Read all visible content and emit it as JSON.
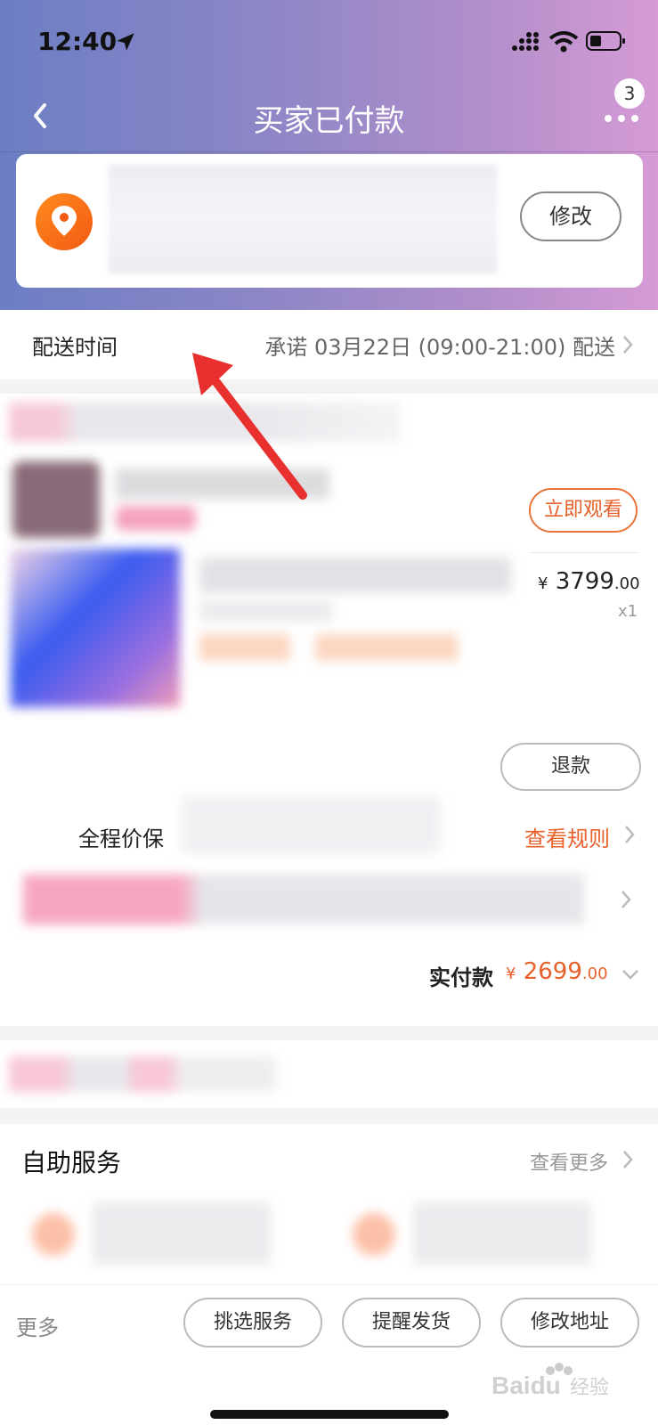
{
  "status_bar": {
    "time": "12:40"
  },
  "nav": {
    "title": "买家已付款",
    "more_badge": "3"
  },
  "address_card": {
    "modify_label": "修改"
  },
  "delivery": {
    "label": "配送时间",
    "value": "承诺 03月22日 (09:00-21:00) 配送"
  },
  "order": {
    "watch_label": "立即观看",
    "price_currency": "¥",
    "price_int": "3799",
    "price_dec": ".00",
    "quantity": "x1",
    "refund_label": "退款",
    "guarantee_label": "全程价保",
    "guarantee_link": "查看规则",
    "paid_label": "实付款",
    "paid_currency": "¥",
    "paid_int": "2699",
    "paid_dec": ".00"
  },
  "self_service": {
    "title": "自助服务",
    "more_label": "查看更多"
  },
  "bottom_bar": {
    "more_label": "更多",
    "buttons": [
      "挑选服务",
      "提醒发货",
      "修改地址"
    ]
  },
  "colors": {
    "accent": "#e8612a",
    "arrow": "#e8302e",
    "pin": "#f25a12"
  },
  "watermark": "Baidu 经验"
}
